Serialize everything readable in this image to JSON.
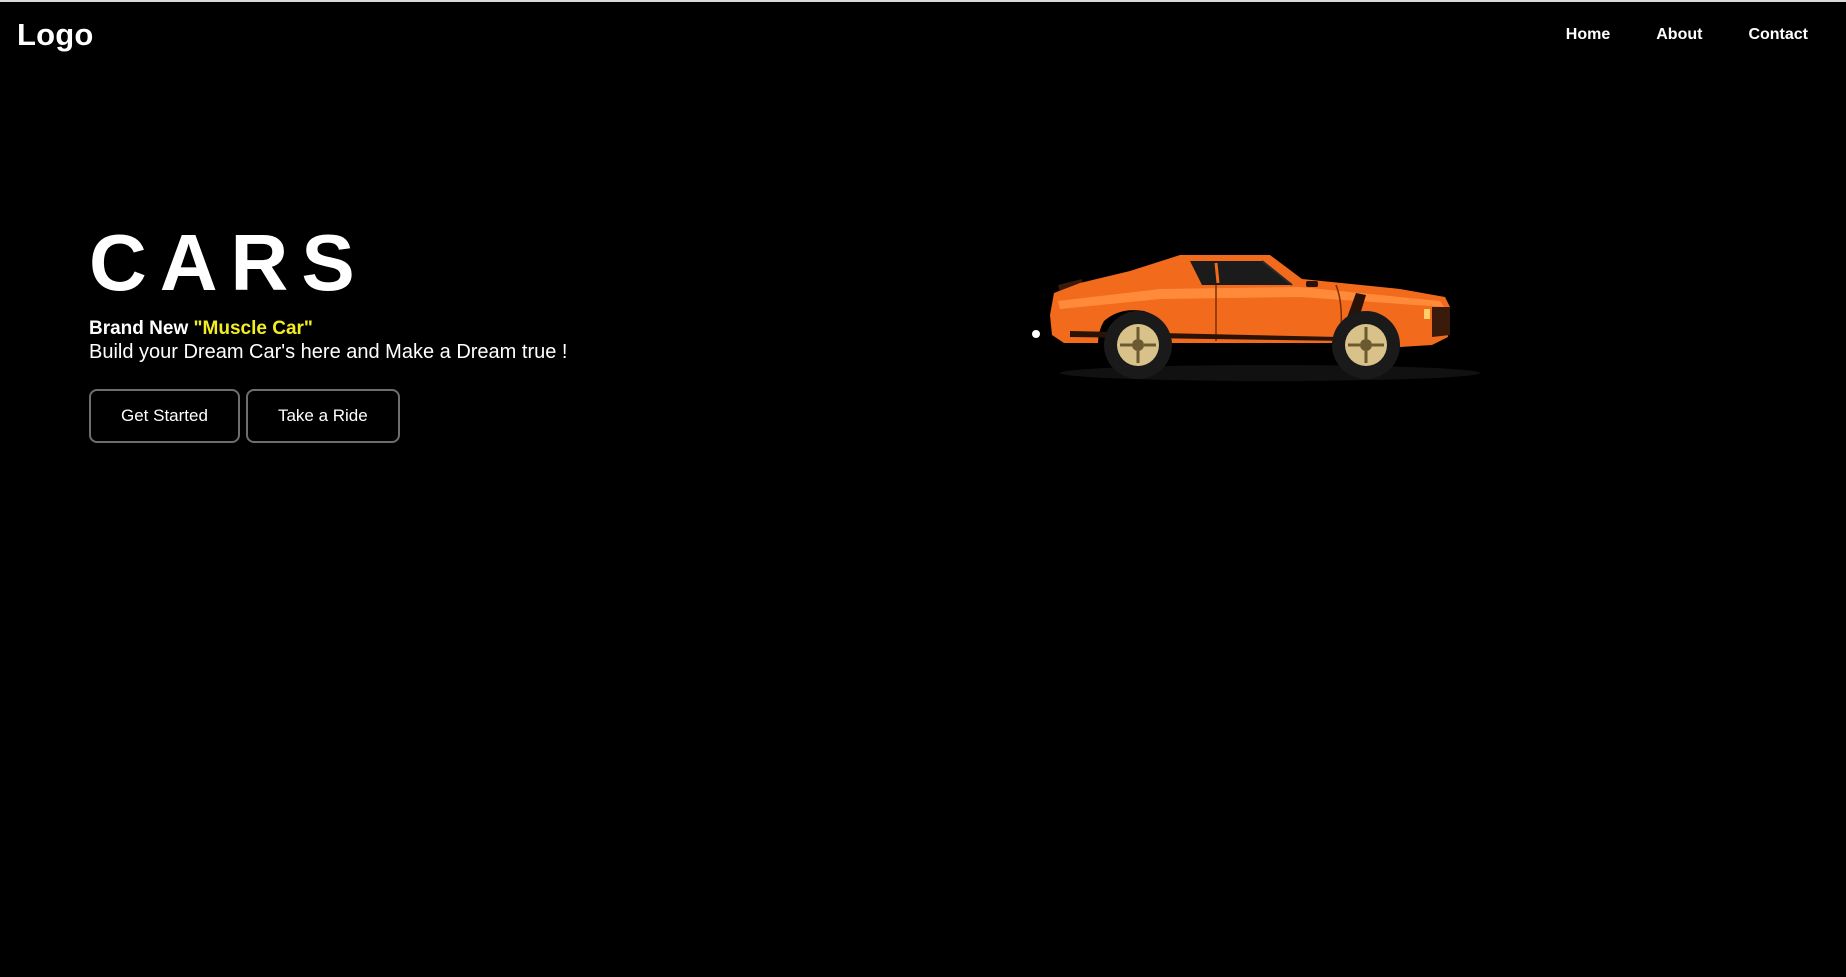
{
  "nav": {
    "logo": "Logo",
    "links": [
      "Home",
      "About",
      "Contact"
    ]
  },
  "hero": {
    "title": "CARS",
    "tagline_prefix": "Brand New",
    "tagline_highlight": "\"Muscle Car\"",
    "subtitle": "Build your Dream Car's here and Make a Dream true !",
    "buttons": [
      "Get Started",
      "Take a Ride"
    ]
  },
  "image": {
    "icon": "muscle-car-illustration"
  },
  "colors": {
    "background": "#000000",
    "highlight": "#f2ee22",
    "car_body": "#f26a1b"
  }
}
